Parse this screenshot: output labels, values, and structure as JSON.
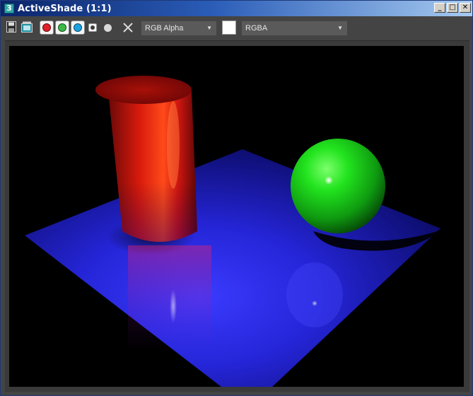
{
  "window": {
    "title": "ActiveShade (1:1)",
    "app_icon_glyph": "3",
    "controls": {
      "minimize": "_",
      "maximize": "□",
      "close": "✕"
    }
  },
  "toolbar": {
    "icons": [
      "save-icon",
      "clone-frame-icon",
      "red-channel-icon",
      "green-channel-icon",
      "blue-channel-icon",
      "alpha-channel-icon",
      "monochrome-icon",
      "clear-icon"
    ],
    "channel_dropdown": {
      "selected": "RGB Alpha",
      "arrow": "▼"
    },
    "color_swatch": {
      "color": "#ffffff"
    },
    "mode_dropdown": {
      "selected": "RGBA",
      "arrow": "▼"
    }
  },
  "render": {
    "background": "#000000",
    "objects": [
      {
        "name": "cylinder",
        "color": "#e82010"
      },
      {
        "name": "sphere",
        "color": "#22dd22"
      },
      {
        "name": "plane",
        "color": "#2020d0"
      }
    ]
  }
}
